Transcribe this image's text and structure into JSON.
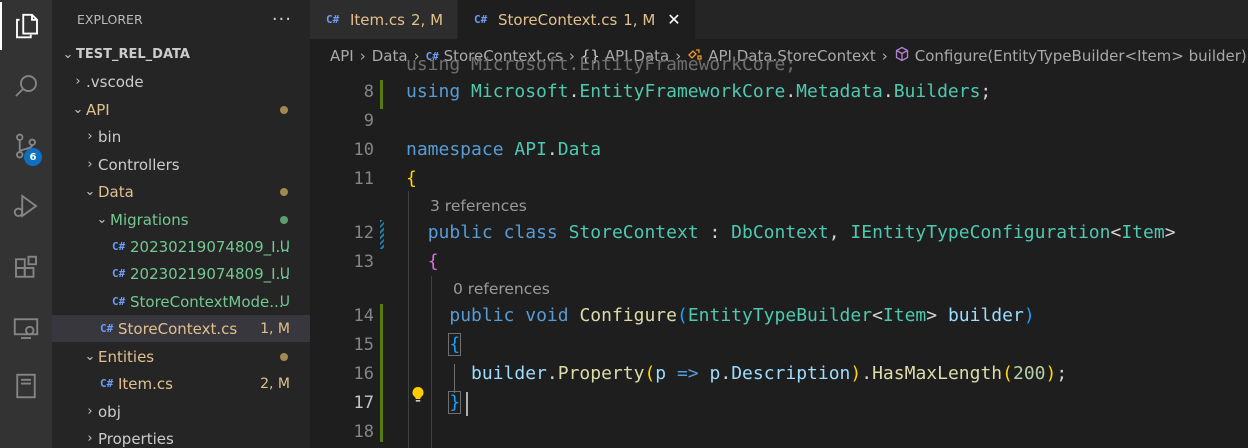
{
  "activity_bar": {
    "items": [
      {
        "icon": "files-icon"
      },
      {
        "icon": "search-icon"
      },
      {
        "icon": "source-control-icon",
        "badge": "6"
      },
      {
        "icon": "run-debug-icon"
      },
      {
        "icon": "extensions-icon"
      },
      {
        "icon": "remote-explorer-icon"
      },
      {
        "icon": "notebook-icon"
      }
    ]
  },
  "sidebar": {
    "title": "EXPLORER",
    "more": "···",
    "root": "TEST_REL_DATA",
    "rows": [
      {
        "label": ".vscode",
        "kind": "folder",
        "open": false,
        "depth": 1,
        "color": "normal",
        "status": "",
        "dot": ""
      },
      {
        "label": "API",
        "kind": "folder",
        "open": true,
        "depth": 1,
        "color": "modified",
        "status": "",
        "dot": "#a08a4f"
      },
      {
        "label": "bin",
        "kind": "folder",
        "open": false,
        "depth": 2,
        "color": "normal",
        "status": "",
        "dot": ""
      },
      {
        "label": "Controllers",
        "kind": "folder",
        "open": false,
        "depth": 2,
        "color": "normal",
        "status": "",
        "dot": ""
      },
      {
        "label": "Data",
        "kind": "folder",
        "open": true,
        "depth": 2,
        "color": "modified",
        "status": "",
        "dot": "#a08a4f"
      },
      {
        "label": "Migrations",
        "kind": "folder",
        "open": true,
        "depth": 3,
        "color": "new",
        "status": "",
        "dot": "#5c9e6c"
      },
      {
        "label": "20230219074809_I...",
        "kind": "file",
        "depth": 4,
        "color": "new",
        "status": "U",
        "dot": ""
      },
      {
        "label": "20230219074809_I...",
        "kind": "file",
        "depth": 4,
        "color": "new",
        "status": "U",
        "dot": ""
      },
      {
        "label": "StoreContextMode...",
        "kind": "file",
        "depth": 4,
        "color": "new",
        "status": "U",
        "dot": ""
      },
      {
        "label": "StoreContext.cs",
        "kind": "file",
        "depth": 3,
        "color": "modified",
        "status": "1, M",
        "dot": "",
        "selected": true
      },
      {
        "label": "Entities",
        "kind": "folder",
        "open": true,
        "depth": 2,
        "color": "modified",
        "status": "",
        "dot": "#a08a4f"
      },
      {
        "label": "Item.cs",
        "kind": "file",
        "depth": 3,
        "color": "modified",
        "status": "2, M",
        "dot": ""
      },
      {
        "label": "obj",
        "kind": "folder",
        "open": false,
        "depth": 2,
        "color": "normal",
        "status": "",
        "dot": ""
      },
      {
        "label": "Properties",
        "kind": "folder",
        "open": false,
        "depth": 2,
        "color": "normal",
        "status": "",
        "dot": ""
      }
    ]
  },
  "tabs": [
    {
      "icon": "C#",
      "name": "Item.cs",
      "status": "2, M",
      "active": false
    },
    {
      "icon": "C#",
      "name": "StoreContext.cs",
      "status": "1, M",
      "active": true,
      "close": "✕"
    }
  ],
  "breadcrumb": {
    "items": [
      {
        "label": "API"
      },
      {
        "label": "Data"
      },
      {
        "icon": "C#",
        "label": "StoreContext.cs"
      },
      {
        "icon": "{}",
        "label": "API.Data"
      },
      {
        "icon": "class",
        "label": "API.Data.StoreContext"
      },
      {
        "icon": "method",
        "label": "Configure(EntityTypeBuilder<Item> builder)"
      }
    ]
  },
  "editor": {
    "partial_line_top": "using Microsoft.EntityFrameworkCore;",
    "lines": [
      {
        "num": "8",
        "code": "using Microsoft.EntityFrameworkCore.Metadata.Builders;"
      },
      {
        "num": "9",
        "code": ""
      },
      {
        "num": "10",
        "code": "namespace API.Data"
      },
      {
        "num": "11",
        "code": "{"
      },
      {
        "lens": "3 references"
      },
      {
        "num": "12",
        "code": "    public class StoreContext : DbContext, IEntityTypeConfiguration<Item>"
      },
      {
        "num": "13",
        "code": "    {"
      },
      {
        "lens": "0 references"
      },
      {
        "num": "14",
        "code": "        public void Configure(EntityTypeBuilder<Item> builder)"
      },
      {
        "num": "15",
        "code": "        {"
      },
      {
        "num": "16",
        "code": "            builder.Property(p => p.Description).HasMaxLength(200);"
      },
      {
        "num": "17",
        "code": "        }"
      },
      {
        "num": "18",
        "code": ""
      }
    ],
    "current_line": "17",
    "colors": {
      "keyword": "#569cd6",
      "type": "#4ec9b0",
      "function": "#dcdcaa",
      "variable": "#9cdcfe",
      "number": "#b5cea8",
      "modified": "#e2c08d",
      "untracked": "#73c991"
    }
  }
}
